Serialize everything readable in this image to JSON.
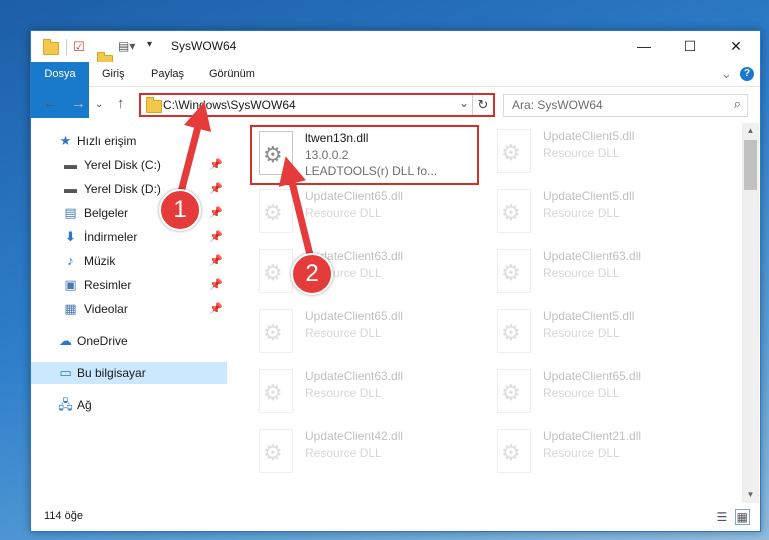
{
  "window": {
    "title": "SysWOW64",
    "controls": {
      "minimize": "—",
      "maximize": "☐",
      "close": "✕"
    }
  },
  "ribbon": {
    "tabs": [
      "Dosya",
      "Giriş",
      "Paylaş",
      "Görünüm"
    ],
    "expand": "⌄",
    "help": "?"
  },
  "address": {
    "path": "C:\\Windows\\SysWOW64",
    "search_placeholder": "Ara: SysWOW64"
  },
  "sidebar": {
    "items": [
      {
        "label": "Hızlı erişim",
        "icon": "star-icon",
        "pinned": false
      },
      {
        "label": "Yerel Disk (C:)",
        "icon": "drive-icon",
        "pinned": true
      },
      {
        "label": "Yerel Disk (D:)",
        "icon": "drive-icon",
        "pinned": true
      },
      {
        "label": "Belgeler",
        "icon": "documents-icon",
        "pinned": true
      },
      {
        "label": "İndirmeler",
        "icon": "download-icon",
        "pinned": true
      },
      {
        "label": "Müzik",
        "icon": "music-icon",
        "pinned": true
      },
      {
        "label": "Resimler",
        "icon": "pictures-icon",
        "pinned": true
      },
      {
        "label": "Videolar",
        "icon": "videos-icon",
        "pinned": true
      },
      {
        "label": "OneDrive",
        "icon": "cloud-icon",
        "pinned": false
      },
      {
        "label": "Bu bilgisayar",
        "icon": "computer-icon",
        "pinned": false
      },
      {
        "label": "Ağ",
        "icon": "network-icon",
        "pinned": false
      }
    ]
  },
  "files": [
    {
      "name": "ltwen13n.dll",
      "line2": "13.0.0.2",
      "line3": "LEADTOOLS(r) DLL fo...",
      "highlight": true
    },
    {
      "name": "UpdateClient5.dll",
      "line2": "Resource DLL",
      "line3": ""
    },
    {
      "name": "UpdateClient65.dll",
      "line2": "Resource DLL",
      "line3": ""
    },
    {
      "name": "UpdateClient5.dll",
      "line2": "Resource DLL",
      "line3": ""
    },
    {
      "name": "UpdateClient63.dll",
      "line2": "Resource DLL",
      "line3": ""
    },
    {
      "name": "UpdateClient63.dll",
      "line2": "Resource DLL",
      "line3": ""
    },
    {
      "name": "UpdateClient65.dll",
      "line2": "Resource DLL",
      "line3": ""
    },
    {
      "name": "UpdateClient5.dll",
      "line2": "Resource DLL",
      "line3": ""
    },
    {
      "name": "UpdateClient63.dll",
      "line2": "Resource DLL",
      "line3": ""
    },
    {
      "name": "UpdateClient65.dll",
      "line2": "Resource DLL",
      "line3": ""
    },
    {
      "name": "UpdateClient42.dll",
      "line2": "Resource DLL",
      "line3": ""
    },
    {
      "name": "UpdateClient21.dll",
      "line2": "Resource DLL",
      "line3": ""
    }
  ],
  "status": {
    "count": "114 öğe"
  },
  "annotations": {
    "step1": "1",
    "step2": "2",
    "color": "#e53b3b"
  }
}
